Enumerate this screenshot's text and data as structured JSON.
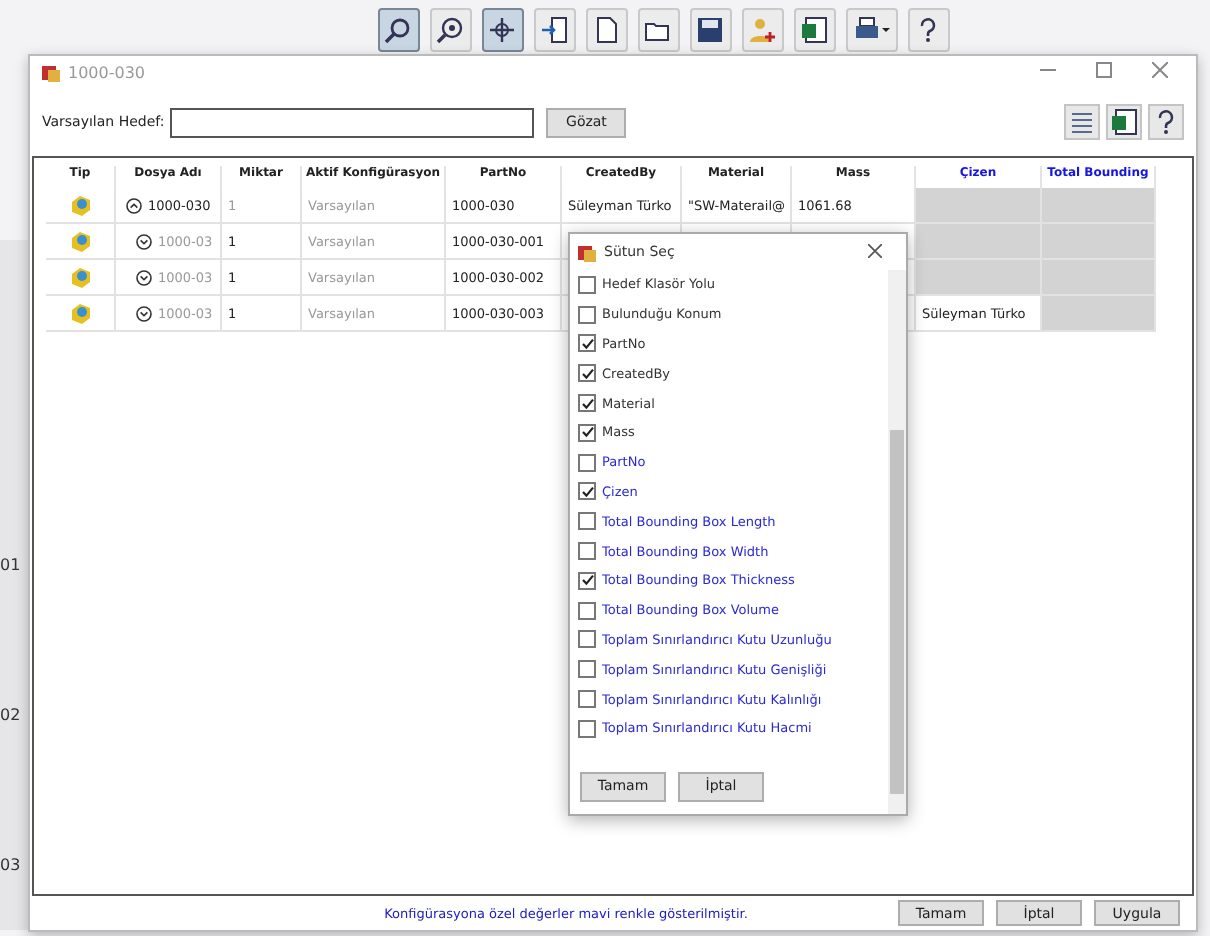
{
  "toolbar": {
    "buttons": [
      {
        "kind": "zoom",
        "selected": true
      },
      {
        "kind": "zoom-fit",
        "selected": false
      },
      {
        "kind": "pan",
        "selected": true
      },
      {
        "kind": "import",
        "selected": false
      },
      {
        "kind": "page",
        "selected": false
      },
      {
        "kind": "open",
        "selected": false
      },
      {
        "kind": "save",
        "selected": false
      },
      {
        "kind": "user",
        "selected": false
      },
      {
        "kind": "excel",
        "selected": false
      },
      {
        "kind": "print",
        "selected": false
      },
      {
        "kind": "help",
        "selected": false
      }
    ]
  },
  "background": {
    "labels": [
      "01",
      "02",
      "03"
    ]
  },
  "window": {
    "title": "1000-030",
    "target": {
      "label": "Varsayılan Hedef:",
      "browse": "Gözat"
    },
    "table": {
      "columns": [
        {
          "label": "Tip",
          "config_specific": false
        },
        {
          "label": "Dosya Adı",
          "config_specific": false
        },
        {
          "label": "Miktar",
          "config_specific": false
        },
        {
          "label": "Aktif Konfigürasyon",
          "config_specific": false
        },
        {
          "label": "PartNo",
          "config_specific": false
        },
        {
          "label": "CreatedBy",
          "config_specific": false
        },
        {
          "label": "Material",
          "config_specific": false
        },
        {
          "label": "Mass",
          "config_specific": false
        },
        {
          "label": "Çizen",
          "config_specific": true
        },
        {
          "label": "Total Bounding",
          "config_specific": true
        }
      ],
      "rows": [
        {
          "name": "1000-030",
          "quantity": "1",
          "configuration": "Varsayılan",
          "part_no": "1000-030",
          "created_by": "Süleyman Türko",
          "material": "\"SW-Materail@",
          "mass": "1061.68",
          "expanded": true,
          "children": [
            {
              "name": "1000-03",
              "quantity": "1",
              "configuration": "Varsayılan",
              "part_no": "1000-030-001",
              "expanded": false
            },
            {
              "name": "1000-03",
              "quantity": "1",
              "configuration": "Varsayılan",
              "part_no": "1000-030-002",
              "expanded": false
            },
            {
              "name": "1000-03",
              "quantity": "1",
              "configuration": "Varsayılan",
              "part_no": "1000-030-003",
              "cizen": "Süleyman Türko",
              "expanded": false
            }
          ]
        }
      ]
    },
    "note": "Konfigürasyona özel değerler mavi renkle gösterilmiştir.",
    "buttons": [
      "Tamam",
      "İptal",
      "Uygula"
    ]
  },
  "column_picker": {
    "title": "Sütun Seç",
    "items": [
      {
        "label": "Hedef Klasör Yolu",
        "checked": false,
        "config_specific": false
      },
      {
        "label": "Bulunduğu Konum",
        "checked": false,
        "config_specific": false
      },
      {
        "label": "PartNo",
        "checked": true,
        "config_specific": false
      },
      {
        "label": "CreatedBy",
        "checked": true,
        "config_specific": false
      },
      {
        "label": "Material",
        "checked": true,
        "config_specific": false
      },
      {
        "label": "Mass",
        "checked": true,
        "config_specific": false
      },
      {
        "label": "PartNo",
        "checked": false,
        "config_specific": true
      },
      {
        "label": "Çizen",
        "checked": true,
        "config_specific": true
      },
      {
        "label": "Total Bounding Box Length",
        "checked": false,
        "config_specific": true
      },
      {
        "label": "Total Bounding Box Width",
        "checked": false,
        "config_specific": true
      },
      {
        "label": "Total Bounding Box Thickness",
        "checked": true,
        "config_specific": true
      },
      {
        "label": "Total Bounding Box Volume",
        "checked": false,
        "config_specific": true
      },
      {
        "label": "Toplam Sınırlandırıcı Kutu Uzunluğu",
        "checked": false,
        "config_specific": true
      },
      {
        "label": "Toplam Sınırlandırıcı Kutu Genişliği",
        "checked": false,
        "config_specific": true
      },
      {
        "label": "Toplam Sınırlandırıcı Kutu Kalınlığı",
        "checked": false,
        "config_specific": true
      },
      {
        "label": "Toplam Sınırlandırıcı Kutu Hacmi",
        "checked": false,
        "config_specific": true
      }
    ],
    "buttons": [
      "Tamam",
      "İptal"
    ]
  }
}
